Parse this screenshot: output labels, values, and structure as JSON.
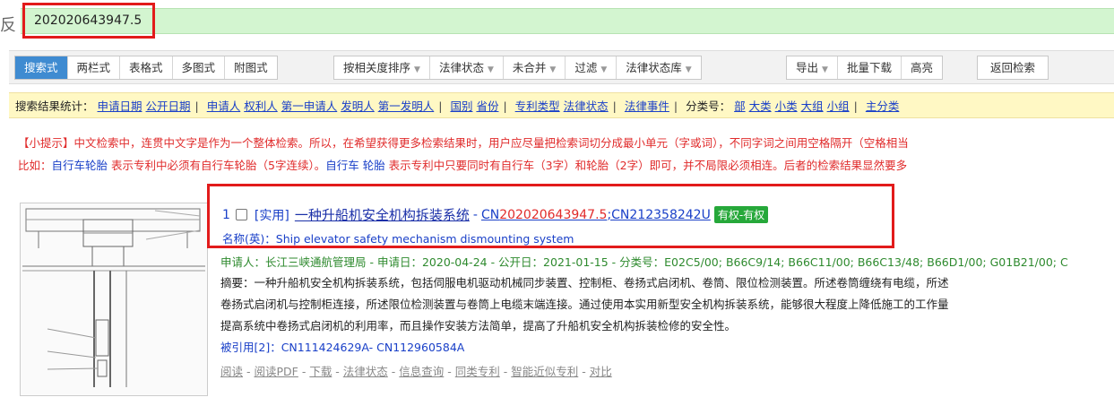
{
  "search": {
    "edge_char": "反",
    "query": "202020643947.5"
  },
  "toolbar": {
    "groups": [
      [
        "搜索式",
        "两栏式",
        "表格式",
        "多图式",
        "附图式"
      ],
      [
        "按相关度排序",
        "法律状态",
        "未合并",
        "过滤",
        "法律状态库"
      ],
      [
        "导出",
        "批量下载",
        "高亮"
      ],
      [
        "返回检索"
      ]
    ]
  },
  "stats": {
    "label": "搜索结果统计：",
    "g1": [
      "申请日期",
      "公开日期"
    ],
    "g2": [
      "申请人",
      "权利人",
      "第一申请人",
      "发明人",
      "第一发明人"
    ],
    "g3": [
      "国别",
      "省份"
    ],
    "g4": [
      "专利类型",
      "法律状态"
    ],
    "g5": [
      "法律事件"
    ],
    "cls_label": "分类号：",
    "g6": [
      "部",
      "大类",
      "小类",
      "大组",
      "小组"
    ],
    "tail": "主分类"
  },
  "tip": {
    "line1": "【小提示】中文检索中，连贯中文字是作为一个整体检索。所以，在希望获得更多检索结果时，用户应尽量把检索词切分成最小单元（字或词），不同字词之间用空格隔开（空格相当",
    "l2a": "比如：",
    "l2b": "自行车轮胎",
    "l2c": " 表示专利中必须有自行车轮胎（5字连续）。",
    "l2d": "自行车 轮胎",
    "l2e": " 表示专利中只要同时有自行车（3字）和轮胎（2字）即可，并不局限必须相连。后者的检索结果显然要多"
  },
  "result": {
    "num": "1",
    "type": "[实用]",
    "title": "一种升船机安全机构拆装系统",
    "dash": "-",
    "pub_prefix": "CN",
    "pub_hl": "202020643947.5",
    "pub_rest": ";CN212358242U",
    "status": "有权-有权",
    "en": "名称(英)：Ship elevator safety mechanism dismounting system",
    "meta": "申请人：长江三峡通航管理局 - 申请日：2020-04-24 - 公开日：2021-01-15 - 分类号：E02C5/00; B66C9/14; B66C11/00; B66C13/48; B66D1/00; G01B21/00; C",
    "abs1": "摘要：一种升船机安全机构拆装系统，包括伺服电机驱动机械同步装置、控制柜、卷扬式启闭机、卷筒、限位检测装置。所述卷筒缠绕有电缆，所述",
    "abs2": "卷扬式启闭机与控制柜连接，所述限位检测装置与卷筒上电缆末端连接。通过使用本实用新型安全机构拆装系统，能够很大程度上降低施工的工作量",
    "abs3": "提高系统中卷扬式启闭机的利用率，而且操作安装方法简单，提高了升船机安全机构拆装检修的安全性。",
    "cited": "被引用[2]：CN111424629A- CN112960584A",
    "actions": [
      "阅读",
      "阅读PDF",
      "下载",
      "法律状态",
      "信息查询",
      "同类专利",
      "智能近似专利",
      "对比"
    ],
    "action_sep": " - "
  }
}
